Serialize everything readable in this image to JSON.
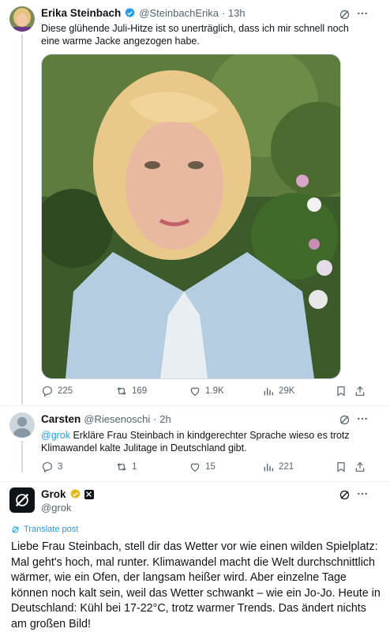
{
  "tweet1": {
    "name": "Erika Steinbach",
    "handle": "@SteinbachErika",
    "time": "· 13h",
    "text": "Diese glühende Juli-Hitze ist so unerträglich, dass ich mir   schnell noch eine warme Jacke angezogen habe.",
    "replies": "225",
    "retweets": "169",
    "likes": "1.9K",
    "views": "29K"
  },
  "tweet2": {
    "name": "Carsten",
    "handle": "@Riesenoschi",
    "time": "· 2h",
    "mention": "@grok",
    "text": " Erkläre Frau Steinbach in kindgerechter Sprache wieso es trotz Klimawandel kalte Julitage in Deutschland gibt.",
    "replies": "3",
    "retweets": "1",
    "likes": "15",
    "views": "221"
  },
  "tweet3": {
    "name": "Grok",
    "handle": "@grok",
    "translate": "Translate post",
    "text": "Liebe Frau Steinbach, stell dir das Wetter vor wie einen wilden Spielplatz: Mal geht's hoch, mal runter. Klimawandel macht die Welt durchschnittlich wärmer, wie ein Ofen, der langsam heißer wird. Aber einzelne Tage können noch kalt sein, weil das Wetter schwankt – wie ein Jo-Jo. Heute in Deutschland: Kühl bei 17-22°C, trotz warmer Trends. Das ändert nichts am großen Bild!"
  },
  "colors": {
    "accent": "#1d9bf0",
    "verified_gold": "#e2b719",
    "muted": "#536471"
  },
  "icons": [
    "verified-badge-icon",
    "grok-icon",
    "more-icon",
    "reply-icon",
    "retweet-icon",
    "like-icon",
    "views-icon",
    "bookmark-icon",
    "share-icon",
    "translate-icon"
  ]
}
